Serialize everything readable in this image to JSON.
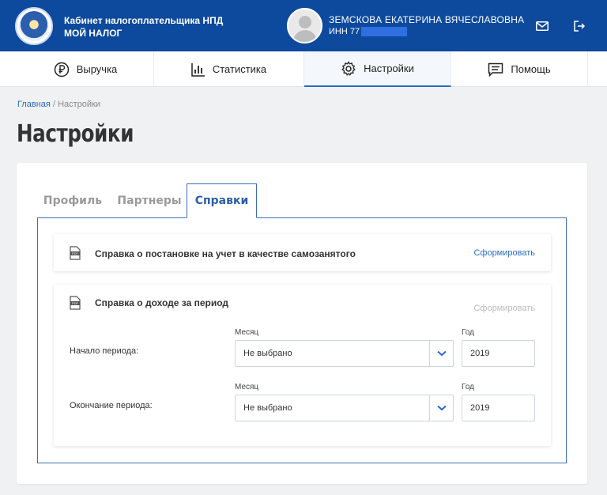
{
  "header": {
    "app_title_line1": "Кабинет налогоплательщика НПД",
    "app_title_line2": "МОЙ НАЛОГ",
    "user_name": "ЗЕМСКОВА ЕКАТЕРИНА ВЯЧЕСЛАВОВНА",
    "inn_prefix": "ИНН 77",
    "icons": [
      "mail-icon",
      "logout-icon"
    ]
  },
  "nav": {
    "items": [
      {
        "label": "Выручка",
        "icon": "ruble-icon"
      },
      {
        "label": "Статистика",
        "icon": "bar-chart-icon"
      },
      {
        "label": "Настройки",
        "icon": "gear-icon",
        "active": true
      },
      {
        "label": "Помощь",
        "icon": "chat-icon"
      }
    ]
  },
  "breadcrumb": {
    "home": "Главная",
    "separator": "/",
    "current": "Настройки"
  },
  "page_title": "Настройки",
  "tabs": [
    {
      "label": "Профиль"
    },
    {
      "label": "Партнеры"
    },
    {
      "label": "Справки",
      "active": true
    }
  ],
  "cert_registration": {
    "title": "Справка о постановке на учет в качестве самозанятого",
    "action": "Сформировать"
  },
  "cert_income": {
    "title": "Справка о доходе за период",
    "action": "Сформировать",
    "start": {
      "label": "Начало периода:",
      "month_label": "Месяц",
      "month_value": "Не выбрано",
      "year_label": "Год",
      "year_value": "2019"
    },
    "end": {
      "label": "Окончание периода:",
      "month_label": "Месяц",
      "month_value": "Не выбрано",
      "year_label": "Год",
      "year_value": "2019"
    }
  },
  "colors": {
    "header_bg": "#0d4a9e",
    "accent": "#2b6cc2",
    "panel_border": "#3b6fb6"
  }
}
